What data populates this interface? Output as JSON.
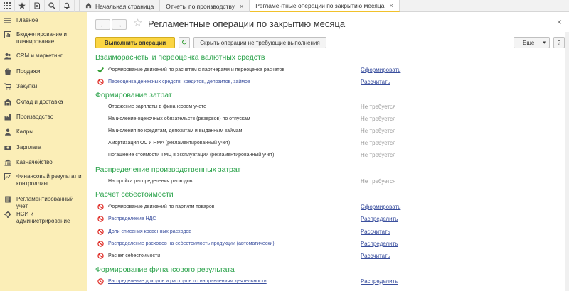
{
  "topbar": {
    "icons": [
      "grid-icon",
      "star-icon",
      "history-icon",
      "search-icon",
      "bell-icon"
    ],
    "tabs": [
      {
        "label": "Начальная страница",
        "closable": false
      },
      {
        "label": "Отчеты по производству",
        "closable": true
      },
      {
        "label": "Регламентные операции по закрытию месяца",
        "closable": true,
        "active": true
      }
    ]
  },
  "sidebar": {
    "items": [
      {
        "label": "Главное",
        "icon": "menu-icon"
      },
      {
        "label": "Бюджетирование и планирование",
        "icon": "budget-icon"
      },
      {
        "label": "CRM и маркетинг",
        "icon": "crm-icon"
      },
      {
        "label": "Продажи",
        "icon": "sales-icon"
      },
      {
        "label": "Закупки",
        "icon": "purchases-icon"
      },
      {
        "label": "Склад и доставка",
        "icon": "warehouse-icon"
      },
      {
        "label": "Производство",
        "icon": "production-icon"
      },
      {
        "label": "Кадры",
        "icon": "hr-icon"
      },
      {
        "label": "Зарплата",
        "icon": "salary-icon"
      },
      {
        "label": "Казначейство",
        "icon": "treasury-icon"
      },
      {
        "label": "Финансовый результат и контроллинг",
        "icon": "finance-icon"
      },
      {
        "label": "Регламентированный учет",
        "icon": "regulated-icon"
      },
      {
        "label": "НСИ и администрирование",
        "icon": "admin-icon"
      }
    ]
  },
  "header": {
    "back": "←",
    "forward": "→",
    "title": "Регламентные операции по закрытию месяца",
    "close": "×"
  },
  "toolbar": {
    "run_label": "Выполнить операции",
    "refresh_symbol": "↻",
    "hide_label": "Скрыть операции не требующие выполнения",
    "more_label": "Еще",
    "more_arrow": "▾",
    "help_label": "?"
  },
  "sections": [
    {
      "title": "Взаиморасчеты и переоценка валютных средств",
      "rows": [
        {
          "text": "Формирование движений по расчетам с партнерами и переоценка расчетов",
          "status": "ok",
          "action": "Сформировать",
          "action_style": "link",
          "text_link": false
        },
        {
          "text": "Переоценка денежных средств, кредитов, депозитов, займов",
          "status": "error",
          "action": "Рассчитать",
          "action_style": "link",
          "text_link": true
        }
      ]
    },
    {
      "title": "Формирование затрат",
      "rows": [
        {
          "text": "Отражение зарплаты в финансовом учете",
          "status": "none",
          "action": "Не требуется",
          "action_style": "muted",
          "text_link": false
        },
        {
          "text": "Начисление оценочных обязательств (резервов) по отпускам",
          "status": "none",
          "action": "Не требуется",
          "action_style": "muted",
          "text_link": false
        },
        {
          "text": "Начисления по кредитам, депозитам и выданным займам",
          "status": "none",
          "action": "Не требуется",
          "action_style": "muted",
          "text_link": false
        },
        {
          "text": "Амортизация ОС и НМА (регламентированный учет)",
          "status": "none",
          "action": "Не требуется",
          "action_style": "muted",
          "text_link": false
        },
        {
          "text": "Погашение стоимости ТМЦ в эксплуатации (регламентированный учет)",
          "status": "none",
          "action": "Не требуется",
          "action_style": "muted",
          "text_link": false
        }
      ]
    },
    {
      "title": "Распределение производственных затрат",
      "rows": [
        {
          "text": "Настройка распределения расходов",
          "status": "none",
          "action": "Не требуется",
          "action_style": "muted",
          "text_link": false
        }
      ]
    },
    {
      "title": "Расчет себестоимости",
      "rows": [
        {
          "text": "Формирование движений по партиям товаров",
          "status": "error",
          "action": "Сформировать",
          "action_style": "link",
          "text_link": false
        },
        {
          "text": "Распределение НДС",
          "status": "error",
          "action": "Распределить",
          "action_style": "link",
          "text_link": true
        },
        {
          "text": "Доли списания косвенных расходов",
          "status": "error",
          "action": "Рассчитать",
          "action_style": "link",
          "text_link": true
        },
        {
          "text": "Распределение расходов на себестоимость продукции (автоматически)",
          "status": "error",
          "action": "Распределить",
          "action_style": "link",
          "text_link": true
        },
        {
          "text": "Расчет себестоимости",
          "status": "error",
          "action": "Рассчитать",
          "action_style": "link",
          "text_link": false
        }
      ]
    },
    {
      "title": "Формирование финансового результата",
      "rows": [
        {
          "text": "Распределение доходов и расходов по направлениям деятельности",
          "status": "error",
          "action": "Распределить",
          "action_style": "link",
          "text_link": true
        }
      ]
    }
  ],
  "colors": {
    "section_title": "#2aa24a",
    "link": "#3a4f9e",
    "muted": "#9a9a9a",
    "primary_button": "#fbd543",
    "sidebar_bg": "#fbeeb7",
    "ok_check": "#2e9a2e",
    "error_icon": "#e0312b"
  }
}
